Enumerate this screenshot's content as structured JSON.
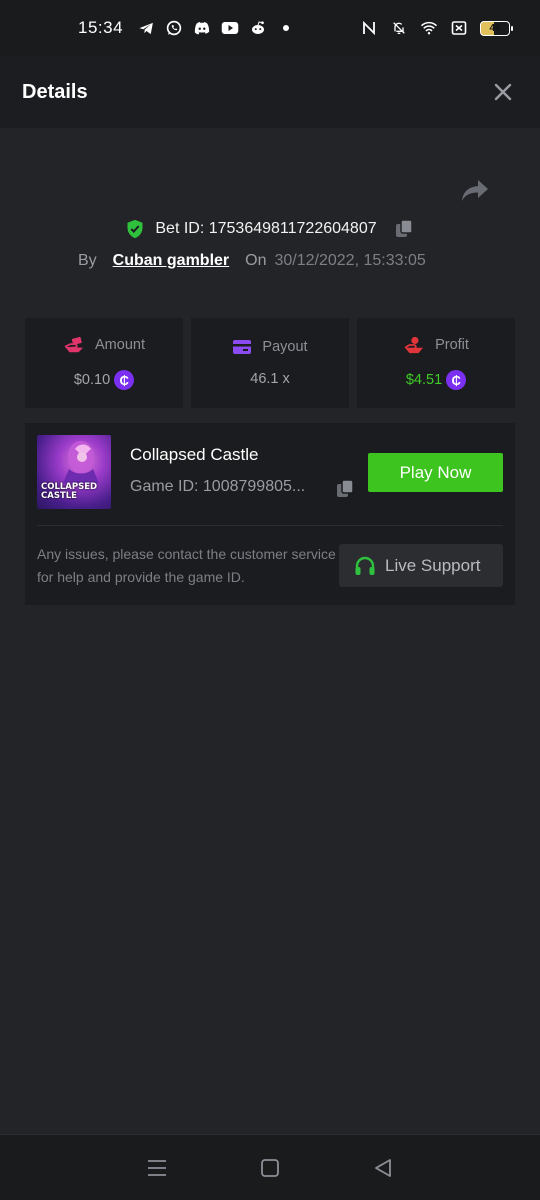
{
  "status_bar": {
    "time": "15:34",
    "battery": "46",
    "left_icons": [
      "telegram-icon",
      "whatsapp-icon",
      "discord-icon",
      "youtube-icon",
      "reddit-icon",
      "dot-icon"
    ],
    "right_icons": [
      "nfc-icon",
      "bell-muted-icon",
      "wifi-icon",
      "sim-x-icon",
      "battery-icon"
    ]
  },
  "header": {
    "title": "Details",
    "close_icon": "close-icon"
  },
  "bet": {
    "id_label": "Bet ID: 1753649811722604807",
    "by_label": "By",
    "user": "Cuban gambler",
    "on_label": "On",
    "date": "30/12/2022, 15:33:05"
  },
  "stats": [
    {
      "label": "Amount",
      "value": "$0.10",
      "icon": "money-hand-icon",
      "icon_color": "#e0356b",
      "coin": "₵"
    },
    {
      "label": "Payout",
      "value": "46.1 x",
      "icon": "card-icon",
      "icon_color": "#8c4bf0"
    },
    {
      "label": "Profit",
      "value": "$4.51",
      "icon": "profit-hand-icon",
      "icon_color": "#e0353a",
      "coin": "₵"
    }
  ],
  "game": {
    "name": "Collapsed Castle",
    "id_label": "Game ID: 1008799805...",
    "thumb_line1": "COLLAPSED",
    "thumb_line2": "CASTLE",
    "play_label": "Play Now",
    "notice": "Any issues, please contact the customer service for help and provide the game ID.",
    "support_label": "Live Support"
  },
  "colors": {
    "accent_green": "#3dc41e",
    "profit_green": "#3fcb27",
    "coin_purple": "#7b2ff0",
    "shield_green": "#2fc13d"
  }
}
